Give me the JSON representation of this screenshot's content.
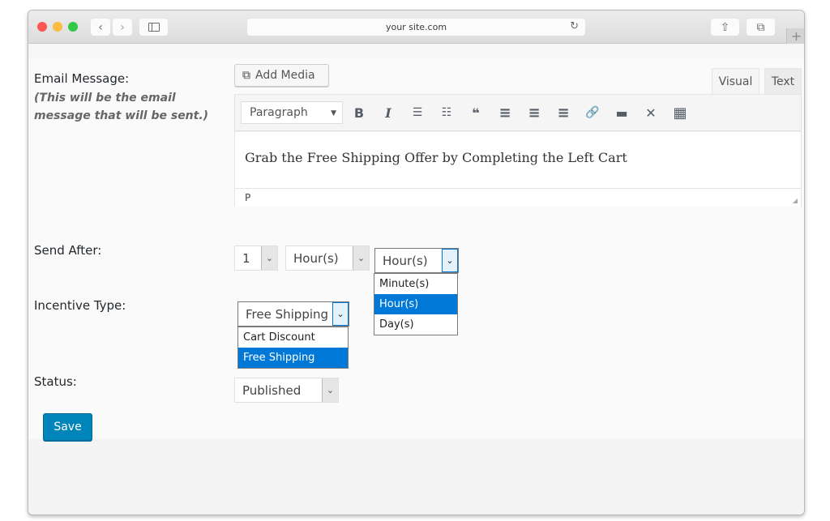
{
  "browser": {
    "url": "your site.com",
    "traffic_lights": [
      "close",
      "minimize",
      "zoom"
    ],
    "colors": {
      "close": "#fc5753",
      "minimize": "#fdbc40",
      "zoom": "#33c748"
    },
    "icons": {
      "back": "‹",
      "forward": "›",
      "reload": "↻",
      "share": "⇧",
      "tabs": "⧉",
      "new_tab": "+"
    }
  },
  "form": {
    "email_message": {
      "label": "Email Message:",
      "hint": "(This will be the email message that will be sent.)",
      "add_media_label": "Add Media",
      "tabs": {
        "visual": "Visual",
        "text": "Text",
        "active": "Visual"
      },
      "format_select": "Paragraph",
      "toolbar": [
        {
          "name": "bold",
          "glyph": "B"
        },
        {
          "name": "italic",
          "glyph": "I"
        },
        {
          "name": "bullet-list",
          "glyph": "☰"
        },
        {
          "name": "numbered-list",
          "glyph": "☷"
        },
        {
          "name": "blockquote",
          "glyph": "❝"
        },
        {
          "name": "align-left",
          "glyph": "≡"
        },
        {
          "name": "align-center",
          "glyph": "≡"
        },
        {
          "name": "align-right",
          "glyph": "≡"
        },
        {
          "name": "link",
          "glyph": "🔗"
        },
        {
          "name": "read-more",
          "glyph": "▬"
        },
        {
          "name": "fullscreen",
          "glyph": "✕"
        },
        {
          "name": "toolbar-toggle",
          "glyph": "▦"
        }
      ],
      "content": "Grab the Free Shipping Offer by Completing the Left Cart",
      "path": "P"
    },
    "send_after": {
      "label": "Send After:",
      "amount": "1",
      "unit": "Hour(s)",
      "open_unit": "Hour(s)",
      "options": [
        "Minute(s)",
        "Hour(s)",
        "Day(s)"
      ],
      "highlighted": "Hour(s)"
    },
    "incentive_type": {
      "label": "Incentive Type:",
      "value": "Free Shipping",
      "options": [
        "Cart Discount",
        "Free Shipping"
      ],
      "highlighted": "Free Shipping"
    },
    "status": {
      "label": "Status:",
      "value": "Published"
    },
    "save_label": "Save"
  },
  "colors": {
    "primary_button": "#0085ba",
    "highlight": "#0078d7"
  }
}
